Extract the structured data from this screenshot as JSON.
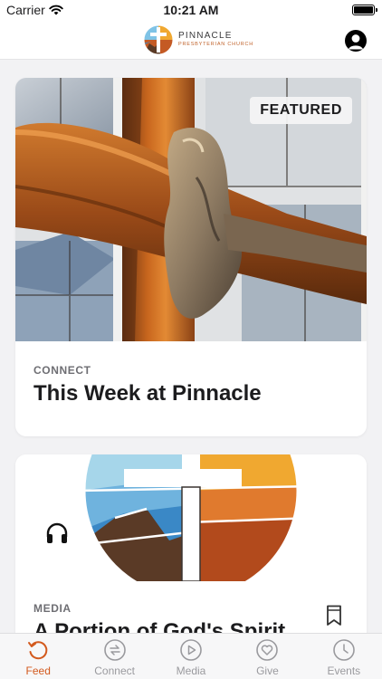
{
  "status": {
    "carrier": "Carrier",
    "time": "10:21 AM",
    "battery": 1.0
  },
  "header": {
    "logo_name": "PINNACLE",
    "logo_sub": "PRESBYTERIAN CHURCH"
  },
  "feed": [
    {
      "badge": "FEATURED",
      "category": "CONNECT",
      "title": "This Week at Pinnacle"
    },
    {
      "category": "MEDIA",
      "title": "A Portion of God's Spirit"
    }
  ],
  "tabs": [
    {
      "label": "Feed",
      "icon": "feed-icon",
      "active": true
    },
    {
      "label": "Connect",
      "icon": "connect-icon"
    },
    {
      "label": "Media",
      "icon": "play-icon"
    },
    {
      "label": "Give",
      "icon": "heart-icon"
    },
    {
      "label": "Events",
      "icon": "clock-icon"
    }
  ],
  "colors": {
    "accent": "#d35a1e",
    "inactive": "#9a9a9e"
  }
}
